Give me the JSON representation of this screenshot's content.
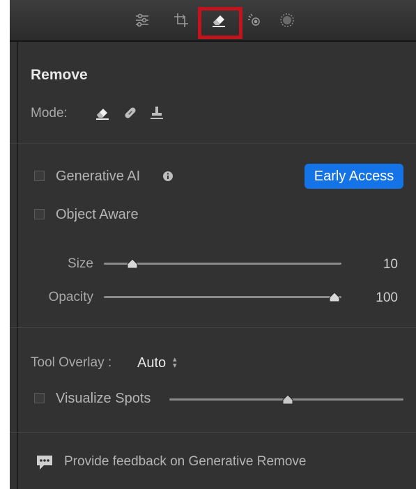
{
  "toolbar": {
    "tools": [
      {
        "icon": "edit-sliders-icon",
        "active": false
      },
      {
        "icon": "crop-icon",
        "active": false
      },
      {
        "icon": "eraser-icon",
        "active": true
      },
      {
        "icon": "red-eye-icon",
        "active": false
      },
      {
        "icon": "masking-icon",
        "active": false
      }
    ],
    "highlight_color": "#c1141c"
  },
  "panel": {
    "title": "Remove",
    "mode_label": "Mode:",
    "modes": [
      "remove-eraser-icon",
      "heal-bandage-icon",
      "clone-stamp-icon"
    ],
    "generative_ai": {
      "label": "Generative AI",
      "checked": false,
      "badge": "Early Access",
      "badge_color": "#1473e6"
    },
    "object_aware": {
      "label": "Object Aware",
      "checked": false
    },
    "size": {
      "label": "Size",
      "value": "10",
      "level": 0.1
    },
    "opacity": {
      "label": "Opacity",
      "value": "100",
      "level": 1.0
    },
    "tool_overlay": {
      "label": "Tool Overlay :",
      "value": "Auto"
    },
    "visualize_spots": {
      "label": "Visualize Spots",
      "checked": false,
      "level": 0.5
    },
    "feedback": {
      "text": "Provide feedback on Generative Remove"
    }
  }
}
